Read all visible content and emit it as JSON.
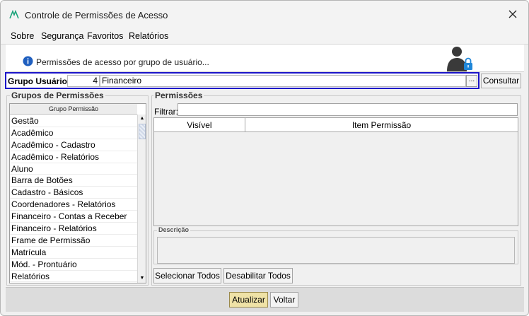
{
  "window": {
    "title": "Controle de Permissões de Acesso"
  },
  "menu": [
    {
      "label": "Sobre"
    },
    {
      "label": "Segurança"
    },
    {
      "label": "Favoritos"
    },
    {
      "label": "Relatórios"
    }
  ],
  "header": {
    "info_text": "Permissões de acesso por grupo de usuário..."
  },
  "grupo_usuario": {
    "label": "Grupo Usuário:",
    "code": "4",
    "name": "Financeiro",
    "lookup_label": "...",
    "consultar_label": "Consultar"
  },
  "grupos_permissoes": {
    "title": "Grupos de Permissões",
    "column_header": "Grupo Permissão",
    "items": [
      "Gestão",
      "Acadêmico",
      "Acadêmico - Cadastro",
      "Acadêmico - Relatórios",
      "Aluno",
      "Barra de Botões",
      "Cadastro - Básicos",
      "Coordenadores - Relatórios",
      "Financeiro - Contas a Receber",
      "Financeiro - Relatórios",
      "Frame de Permissão",
      "Matrícula",
      "Mód. - Prontuário",
      "Relatórios"
    ]
  },
  "permissoes": {
    "title": "Permissões",
    "filter_label": "Filtrar:",
    "filter_value": "",
    "columns": [
      "Visível",
      "Item Permissão"
    ],
    "descricao_label": "Descrição",
    "select_all_label": "Selecionar Todos",
    "disable_all_label": "Desabilitar Todos"
  },
  "footer": {
    "atualizar_label": "Atualizar",
    "voltar_label": "Voltar"
  },
  "colors": {
    "highlight_border": "#1b14c8",
    "primary_button": "#efe2a6",
    "info_icon": "#1f5fbf",
    "app_icon": "#1aa37a"
  }
}
